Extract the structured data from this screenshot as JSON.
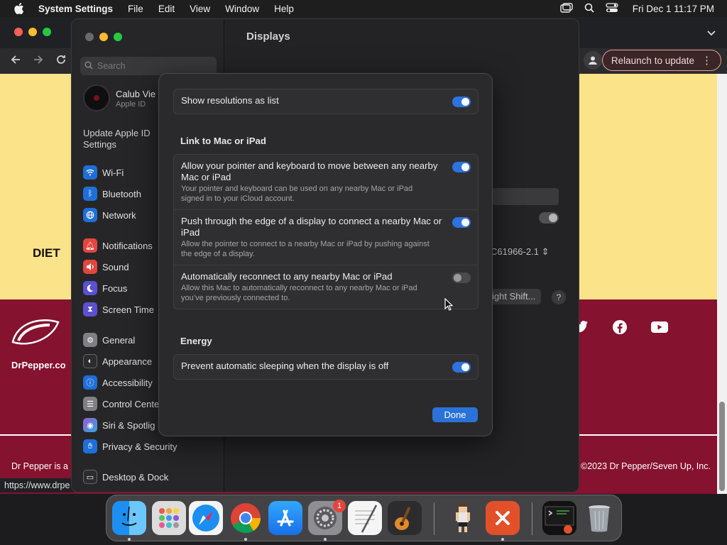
{
  "menubar": {
    "app_name": "System Settings",
    "menus": [
      "File",
      "Edit",
      "View",
      "Window",
      "Help"
    ],
    "clock": "Fri Dec 1  11:17 PM"
  },
  "browser": {
    "relaunch_label": "Relaunch to update",
    "status_url": "https://www.drpe",
    "page": {
      "diet_text": "DIET",
      "site_text": "DrPepper.co",
      "footer_left": "Dr Pepper is a r",
      "copyright": "©2023 Dr Pepper/Seven Up, Inc."
    }
  },
  "settings": {
    "title": "Displays",
    "search_placeholder": "Search",
    "profile": {
      "name": "Calub Vie",
      "sub": "Apple ID"
    },
    "update_apple_id": "Update Apple ID Settings",
    "sidebar_items": [
      {
        "label": "Wi-Fi",
        "icon": "wifi-icon",
        "color": "#1f6fd8"
      },
      {
        "label": "Bluetooth",
        "icon": "bluetooth-icon",
        "color": "#1f6fd8"
      },
      {
        "label": "Network",
        "icon": "globe-icon",
        "color": "#1f6fd8"
      },
      {
        "label": "Notifications",
        "icon": "bell-icon",
        "color": "#e2463e"
      },
      {
        "label": "Sound",
        "icon": "speaker-icon",
        "color": "#e2463e"
      },
      {
        "label": "Focus",
        "icon": "moon-icon",
        "color": "#5b4fd2"
      },
      {
        "label": "Screen Time",
        "icon": "hourglass-icon",
        "color": "#5b4fd2"
      },
      {
        "label": "General",
        "icon": "gear-icon",
        "color": "#7f7f84"
      },
      {
        "label": "Appearance",
        "icon": "appearance-icon",
        "color": "#2c2c2e"
      },
      {
        "label": "Accessibility",
        "icon": "accessibility-icon",
        "color": "#1f6fd8"
      },
      {
        "label": "Control Cente",
        "icon": "control-center-icon",
        "color": "#7f7f84"
      },
      {
        "label": "Siri & Spotlig",
        "icon": "siri-icon",
        "color": "#9b59d0"
      },
      {
        "label": "Privacy & Security",
        "icon": "hand-icon",
        "color": "#1f6fd8"
      },
      {
        "label": "Desktop & Dock",
        "icon": "dock-icon",
        "color": "#2c2c2e"
      }
    ],
    "bg_select_value": "C61966-2.1",
    "bg_nightshift": "ight Shift...",
    "bg_help": "?"
  },
  "sheet": {
    "row_list": {
      "title": "Show resolutions as list",
      "on": true
    },
    "section_link": "Link to Mac or iPad",
    "link_rows": [
      {
        "title": "Allow your pointer and keyboard to move between any nearby Mac or iPad",
        "desc": "Your pointer and keyboard can be used on any nearby Mac or iPad signed in to your iCloud account.",
        "on": true
      },
      {
        "title": "Push through the edge of a display to connect a nearby Mac or iPad",
        "desc": "Allow the pointer to connect to a nearby Mac or iPad by pushing against the edge of a display.",
        "on": true
      },
      {
        "title": "Automatically reconnect to any nearby Mac or iPad",
        "desc": "Allow this Mac to automatically reconnect to any nearby Mac or iPad you’ve previously connected to.",
        "on": false
      }
    ],
    "section_energy": "Energy",
    "row_energy": {
      "title": "Prevent automatic sleeping when the display is off",
      "on": true
    },
    "done_label": "Done"
  },
  "dock": {
    "apps": [
      "Finder",
      "Launchpad",
      "Safari",
      "Chrome",
      "App Store",
      "System Settings",
      "TextEdit",
      "GarageBand",
      "Game",
      "Remote Desktop",
      "Terminal",
      "Trash"
    ],
    "settings_badge": "1"
  }
}
